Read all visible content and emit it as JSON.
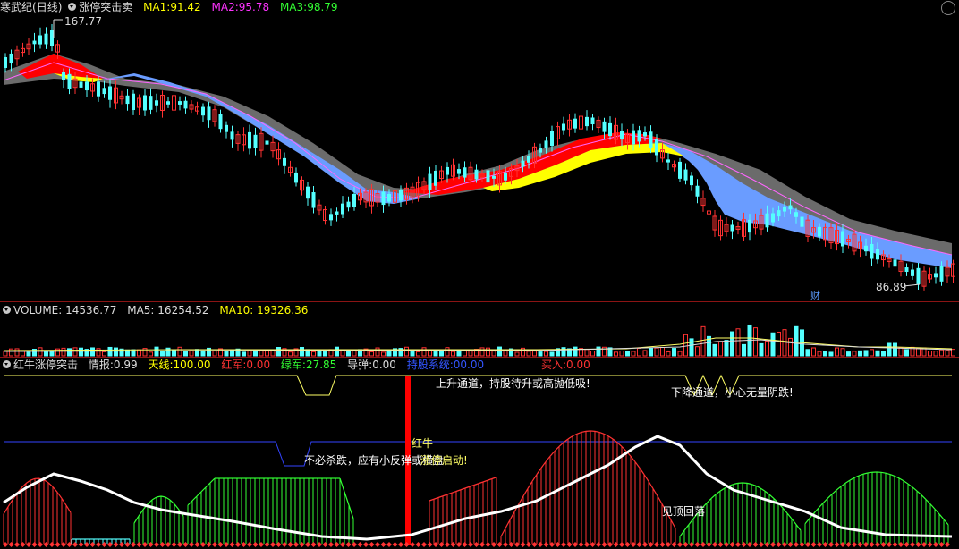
{
  "main": {
    "stock_name": "寒武纪",
    "period": "(日线)",
    "indicator": "涨停突击卖",
    "ma": [
      {
        "label": "MA1:",
        "value": "91.42",
        "color": "#ffff00"
      },
      {
        "label": "MA2:",
        "value": "95.78",
        "color": "#ff33ff"
      },
      {
        "label": "MA3:",
        "value": "98.79",
        "color": "#33ff33"
      }
    ],
    "high_price": "167.77",
    "low_price": "86.89",
    "finance_marker": "财"
  },
  "volume": {
    "label": "VOLUME:",
    "value": "14536.77",
    "ma5_label": "MA5:",
    "ma5": "16254.52",
    "ma10_label": "MA10:",
    "ma10": "19326.36"
  },
  "indicator_panel": {
    "name": "红牛涨停突击",
    "fields": [
      {
        "label": "情报:",
        "value": "0.99",
        "color": "#dddddd"
      },
      {
        "label": "天线:",
        "value": "100.00",
        "color": "#ffff00"
      },
      {
        "label": "红军:",
        "value": "0.00",
        "color": "#ff3333"
      },
      {
        "label": "绿军:",
        "value": "27.85",
        "color": "#33ff33"
      },
      {
        "label": "导弹:",
        "value": "0.00",
        "color": "#dddddd"
      },
      {
        "label": "持股系统:",
        "value": "00.00",
        "color": "#3355ff"
      },
      {
        "label": "买入:",
        "value": "0.00",
        "color": "#ff3333"
      }
    ],
    "annotations": {
      "uptrend": "上升通道，持股待升或高抛低吸!",
      "downtrend": "下降通道，小心无量阴跌!",
      "no_panic": "不必杀跌，应有小反弹或横盘",
      "red_bull": "红牛",
      "rally": "涨停启动!",
      "top_fall": "见顶回落"
    }
  },
  "colors": {
    "up": "#ff3232",
    "down": "#54ffff",
    "separator": "#8b1414",
    "ribbon_red": "#ff0000",
    "ribbon_yellow": "#ffff00",
    "ribbon_blue": "#6699ff",
    "ribbon_gray": "#666666"
  }
}
